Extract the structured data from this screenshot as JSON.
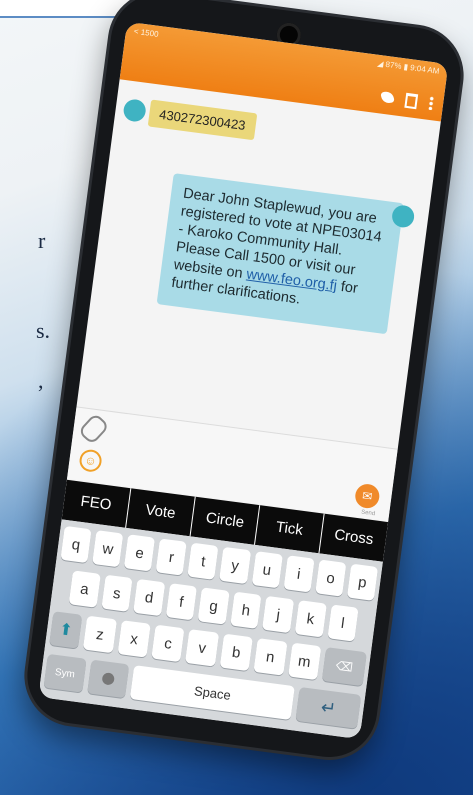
{
  "background": {
    "top_card_text": "",
    "fragments": [
      "r",
      "s.",
      ","
    ]
  },
  "status": {
    "contact": "< 1500",
    "right": "◢ 87% ▮ 9:04 AM"
  },
  "messages": {
    "incoming": "430272300423",
    "outgoing_pre": "Dear John Staplewud, you are registered to vote at NPE03014 - Karoko Community Hall. Please Call 1500 or visit our website on ",
    "outgoing_link": "www.feo.org.fj",
    "outgoing_post": " for further clarifications."
  },
  "compose": {
    "send_label": "Send"
  },
  "suggestions": [
    "FEO",
    "Vote",
    "Circle",
    "Tick",
    "Cross"
  ],
  "keyboard": {
    "row1": [
      "q",
      "w",
      "e",
      "r",
      "t",
      "y",
      "u",
      "i",
      "o",
      "p"
    ],
    "row2": [
      "a",
      "s",
      "d",
      "f",
      "g",
      "h",
      "j",
      "k",
      "l"
    ],
    "row3": [
      "z",
      "x",
      "c",
      "v",
      "b",
      "n",
      "m"
    ],
    "shift": "⬆",
    "backspace": "⌫",
    "sym": "Sym",
    "space": "Space",
    "enter": "↵"
  },
  "colors": {
    "header_orange": "#ef7f14",
    "incoming_bubble": "#ead77a",
    "outgoing_bubble": "#a9dbe7",
    "avatar": "#3fb3c2"
  }
}
